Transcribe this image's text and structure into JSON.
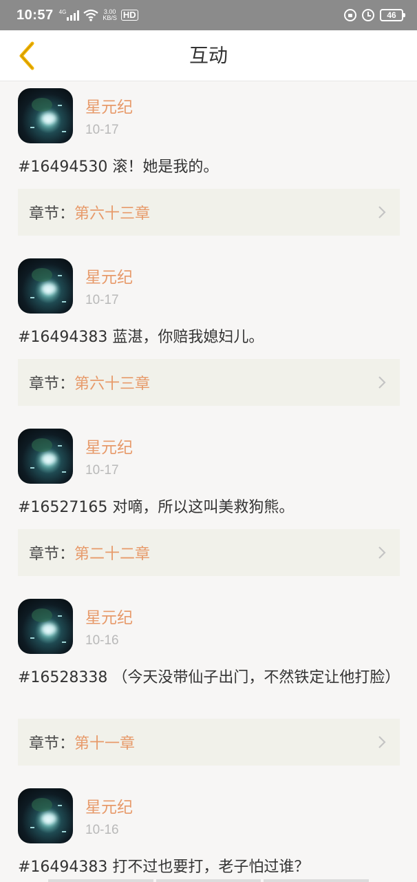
{
  "status_bar": {
    "time": "10:57",
    "network": "4G",
    "speed_top": "3.00",
    "speed_bottom": "KB/S",
    "hd": "HD",
    "battery": "46"
  },
  "header": {
    "title": "互动"
  },
  "colors": {
    "accent_orange": "#e79a6a",
    "back_arrow": "#f2b400"
  },
  "items": [
    {
      "username": "星元纪",
      "date": "10-17",
      "text": "#16494530 滚！她是我的。",
      "chapter_label": "章节：",
      "chapter": "第六十三章"
    },
    {
      "username": "星元纪",
      "date": "10-17",
      "text": "#16494383 蓝湛，你赔我媳妇儿。",
      "chapter_label": "章节：",
      "chapter": "第六十三章"
    },
    {
      "username": "星元纪",
      "date": "10-17",
      "text": "#16527165 对嘀，所以这叫美救狗熊。",
      "chapter_label": "章节：",
      "chapter": "第二十二章"
    },
    {
      "username": "星元纪",
      "date": "10-16",
      "text": "#16528338 （今天没带仙子出门，不然铁定让他打脸）",
      "chapter_label": "章节：",
      "chapter": "第十一章"
    },
    {
      "username": "星元纪",
      "date": "10-16",
      "text": "#16494383 打不过也要打，老子怕过谁？"
    }
  ]
}
